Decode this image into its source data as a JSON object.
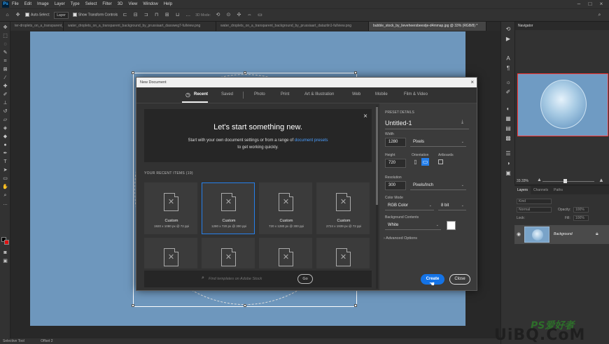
{
  "menubar": {
    "logo": "Ps",
    "items": [
      "File",
      "Edit",
      "Image",
      "Layer",
      "Type",
      "Select",
      "Filter",
      "3D",
      "View",
      "Window",
      "Help"
    ]
  },
  "options": {
    "auto_select": "Auto-Select:",
    "layer_select": "Layer",
    "show_transform": "Show Transform Controls",
    "mode_3d": "3D Mode:"
  },
  "tabs": [
    "ter-droplets_on_a_transparent_background_by_prussiaart_dasoeg6-fullview.png",
    "water_droplets_on_a_transparent_background_by_prussiaart_dassweg7-fullview.png",
    "water_droplets_on_a_transparent_background_by_prussiaart_dataztin1-fullview.png",
    "bubble_stock_by_lieveheersbeestje-d4mmap.jpg @ 33% (RGB/8) *"
  ],
  "navigator": {
    "title": "Navigator",
    "zoom": "33.33%"
  },
  "layers": {
    "tabs": [
      "Layers",
      "Channels",
      "Paths"
    ],
    "kind": "Kind",
    "blend": "Normal",
    "opacity_label": "Opacity:",
    "opacity": "100%",
    "lock_label": "Lock:",
    "fill_label": "Fill:",
    "fill": "100%",
    "layer_name": "Background"
  },
  "status": {
    "left": "Selective Tool",
    "right": "Offset 2"
  },
  "watermark": {
    "top": "PS爱好者",
    "main": "UiBQ.CoM",
    "sub": ""
  },
  "dialog": {
    "title": "New Document",
    "close": "×",
    "tabs": [
      "Recent",
      "Saved",
      "Photo",
      "Print",
      "Art & Illustration",
      "Web",
      "Mobile",
      "Film & Video"
    ],
    "welcome": {
      "heading": "Let's start something new.",
      "line1": "Start with your own document settings or from a range of",
      "link": "document presets",
      "line2": "to get working quickly."
    },
    "recent_label": "YOUR RECENT ITEMS",
    "recent_count": "(19)",
    "cards": [
      {
        "name": "Custom",
        "meta": "1920 x 1080 px @ 72 ppi"
      },
      {
        "name": "Custom",
        "meta": "1280 x 720 px @ 300 ppi"
      },
      {
        "name": "Custom",
        "meta": "720 x 1280 px @ 300 ppi"
      },
      {
        "name": "Custom",
        "meta": "2724 x 1939 px @ 72 ppi"
      }
    ],
    "search_placeholder": "Find templates on Adobe Stock",
    "go": "Go",
    "preset": {
      "section": "PRESET DETAILS",
      "name": "Untitled-1",
      "width_label": "Width",
      "width": "1280",
      "width_unit": "Pixels",
      "height_label": "Height",
      "height": "720",
      "orientation_label": "Orientation",
      "artboards_label": "Artboards",
      "resolution_label": "Resolution",
      "resolution": "300",
      "resolution_unit": "Pixels/Inch",
      "color_mode_label": "Color Mode",
      "color_mode": "RGB Color",
      "bit_depth": "8 bit",
      "bg_label": "Background Contents",
      "bg": "White",
      "advanced": "Advanced Options"
    },
    "create": "Create",
    "close_btn": "Close"
  },
  "colors": {
    "accent": "#1473e6",
    "artboard": "#6e97bd",
    "selection": "#2680eb"
  }
}
